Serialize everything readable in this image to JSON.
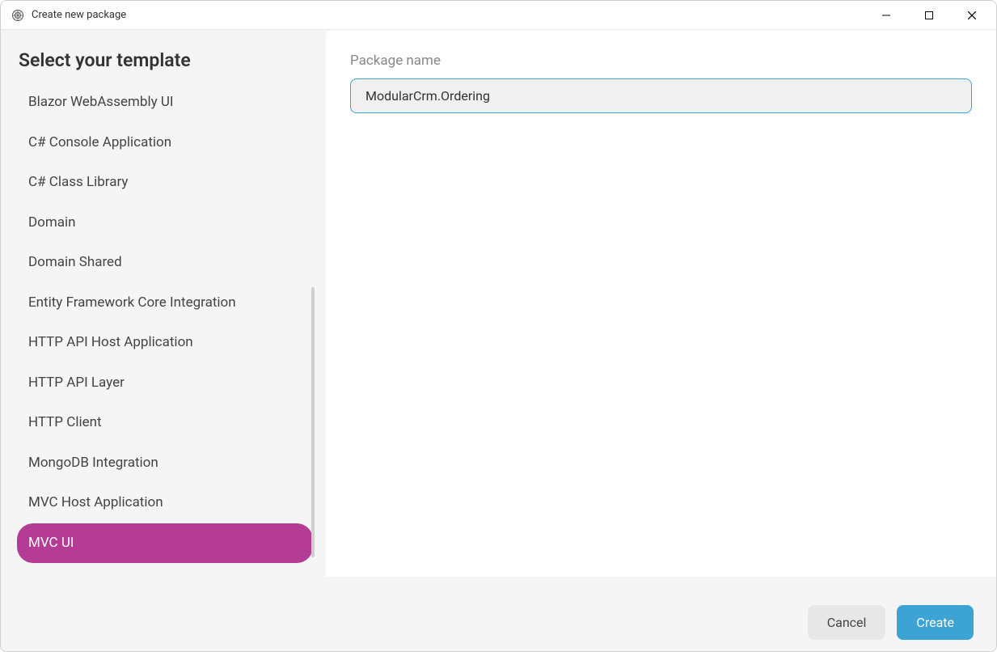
{
  "titlebar": {
    "title": "Create new package"
  },
  "sidebar": {
    "heading": "Select your template",
    "templates": [
      {
        "label": "Blazor WebAssembly UI",
        "selected": false
      },
      {
        "label": "C# Console Application",
        "selected": false
      },
      {
        "label": "C# Class Library",
        "selected": false
      },
      {
        "label": "Domain",
        "selected": false
      },
      {
        "label": "Domain Shared",
        "selected": false
      },
      {
        "label": "Entity Framework Core Integration",
        "selected": false
      },
      {
        "label": "HTTP API Host Application",
        "selected": false
      },
      {
        "label": "HTTP API Layer",
        "selected": false
      },
      {
        "label": "HTTP Client",
        "selected": false
      },
      {
        "label": "MongoDB Integration",
        "selected": false
      },
      {
        "label": "MVC Host Application",
        "selected": false
      },
      {
        "label": "MVC UI",
        "selected": true
      }
    ]
  },
  "main": {
    "package_name_label": "Package name",
    "package_name_value": "ModularCrm.Ordering"
  },
  "footer": {
    "cancel_label": "Cancel",
    "create_label": "Create"
  },
  "colors": {
    "accent": "#3da3d4",
    "selected_bg": "#b43c95"
  }
}
